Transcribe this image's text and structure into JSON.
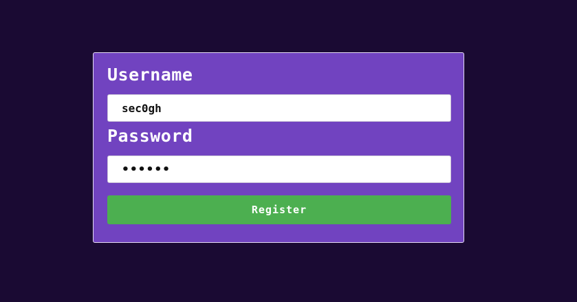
{
  "form": {
    "username_label": "Username",
    "username_value": "sec0gh",
    "password_label": "Password",
    "password_value": "••••••",
    "submit_label": "Register"
  },
  "colors": {
    "background": "#1a0a33",
    "card": "#7143c0",
    "button": "#4caf50"
  }
}
